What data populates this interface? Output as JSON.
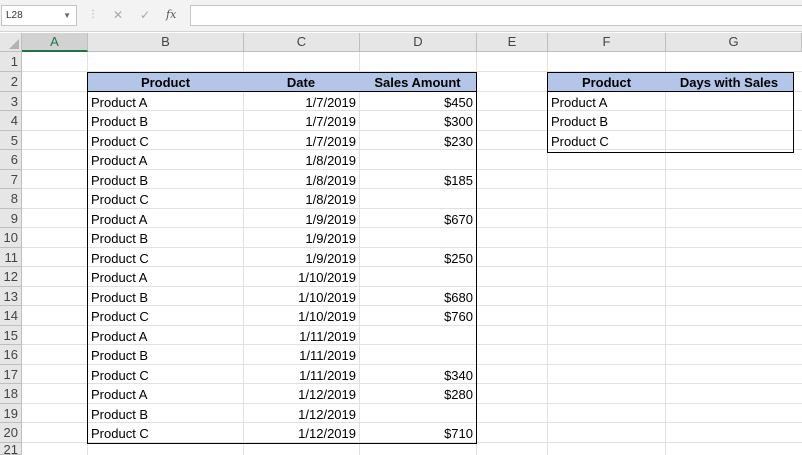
{
  "formula_bar": {
    "name_box": "L28",
    "cancel_icon": "✕",
    "enter_icon": "✓",
    "fx_label": "fx",
    "formula": ""
  },
  "columns": [
    "A",
    "B",
    "C",
    "D",
    "E",
    "F",
    "G"
  ],
  "rows": [
    "1",
    "2",
    "3",
    "4",
    "5",
    "6",
    "7",
    "8",
    "9",
    "10",
    "11",
    "12",
    "13",
    "14",
    "15",
    "16",
    "17",
    "18",
    "19",
    "20",
    "21"
  ],
  "sales_table": {
    "headers": [
      "Product",
      "Date",
      "Sales Amount"
    ],
    "rows": [
      [
        "Product A",
        "1/7/2019",
        "$450"
      ],
      [
        "Product B",
        "1/7/2019",
        "$300"
      ],
      [
        "Product C",
        "1/7/2019",
        "$230"
      ],
      [
        "Product A",
        "1/8/2019",
        ""
      ],
      [
        "Product B",
        "1/8/2019",
        "$185"
      ],
      [
        "Product C",
        "1/8/2019",
        ""
      ],
      [
        "Product A",
        "1/9/2019",
        "$670"
      ],
      [
        "Product B",
        "1/9/2019",
        ""
      ],
      [
        "Product C",
        "1/9/2019",
        "$250"
      ],
      [
        "Product A",
        "1/10/2019",
        ""
      ],
      [
        "Product B",
        "1/10/2019",
        "$680"
      ],
      [
        "Product C",
        "1/10/2019",
        "$760"
      ],
      [
        "Product A",
        "1/11/2019",
        ""
      ],
      [
        "Product B",
        "1/11/2019",
        ""
      ],
      [
        "Product C",
        "1/11/2019",
        "$340"
      ],
      [
        "Product A",
        "1/12/2019",
        "$280"
      ],
      [
        "Product B",
        "1/12/2019",
        ""
      ],
      [
        "Product C",
        "1/12/2019",
        "$710"
      ]
    ]
  },
  "summary_table": {
    "headers": [
      "Product",
      "Days with Sales"
    ],
    "rows": [
      [
        "Product A",
        ""
      ],
      [
        "Product B",
        ""
      ],
      [
        "Product C",
        ""
      ]
    ]
  },
  "colors": {
    "header_fill": "#b4c6e7",
    "selected_column_accent": "#217346"
  }
}
